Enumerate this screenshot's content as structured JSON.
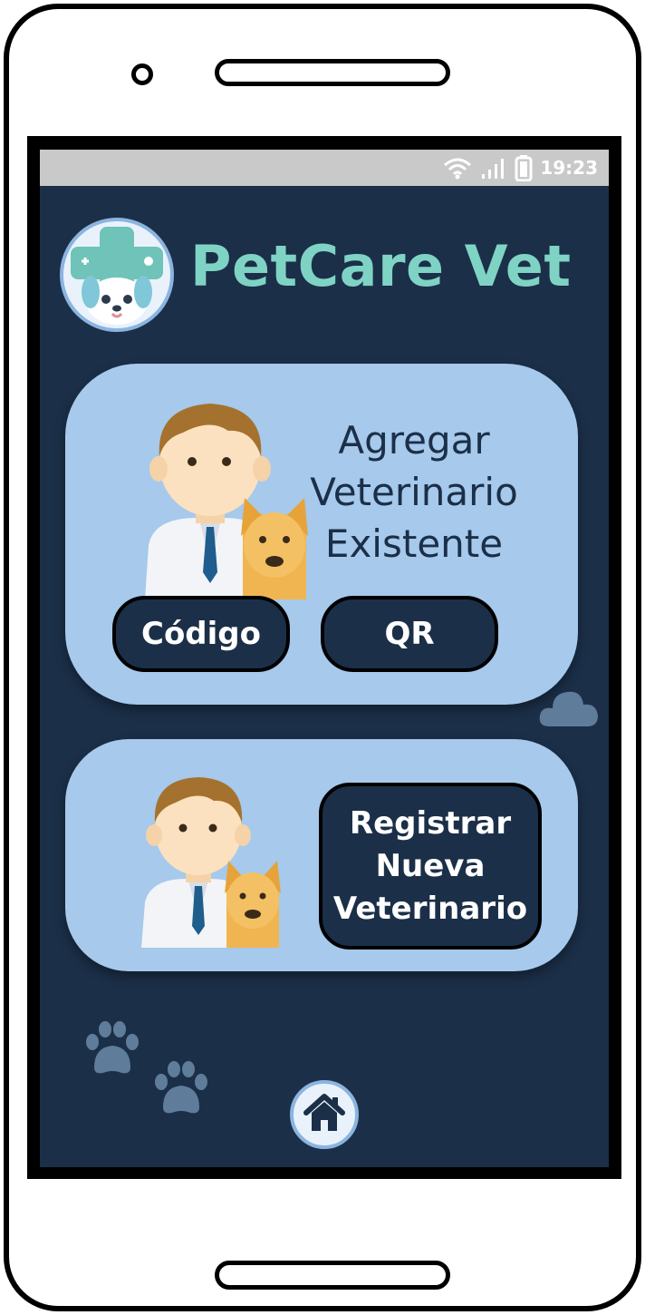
{
  "status_bar": {
    "time": "19:23",
    "icons": [
      "wifi-icon",
      "signal-icon",
      "battery-icon"
    ]
  },
  "header": {
    "app_title": "PetCare Vet",
    "logo_icon": "pet-cross-logo-icon"
  },
  "card_existing": {
    "heading": "Agregar Veterinario Existente",
    "illustration": "vet-with-dog-icon",
    "buttons": {
      "codigo_label": "Código",
      "qr_label": "QR"
    }
  },
  "card_new": {
    "illustration": "vet-with-dog-icon",
    "register_label": "Registrar\nNueva\nVeterinario"
  },
  "nav": {
    "home_icon": "home-icon"
  },
  "decorations": [
    "cloud-icon",
    "paw-print-icon",
    "paw-print-icon"
  ],
  "colors": {
    "screen_bg": "#1b2f48",
    "card_bg": "#a6c9ec",
    "title": "#7fd3c4",
    "button_bg": "#1b2f48"
  }
}
